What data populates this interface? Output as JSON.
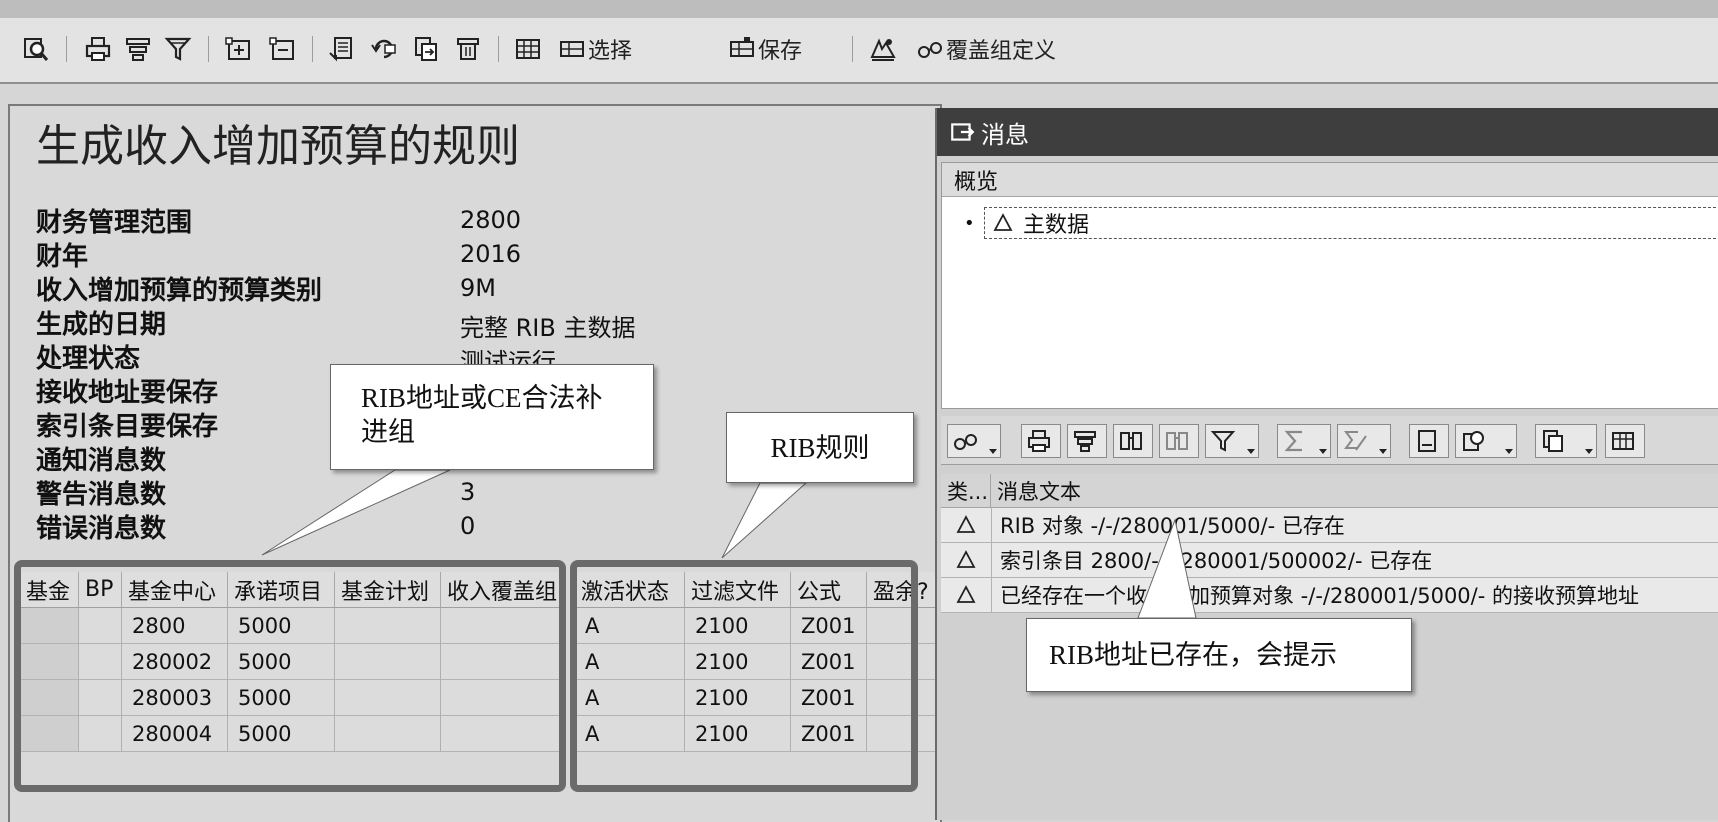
{
  "toolbar": {
    "buttons": [
      {
        "name": "details-button",
        "icon": "magnifier-icon"
      },
      {
        "name": "print-button",
        "icon": "printer-icon"
      },
      {
        "name": "sort-button",
        "icon": "sort-icon"
      },
      {
        "name": "filter-button",
        "icon": "funnel-icon"
      },
      {
        "name": "expand-button",
        "icon": "expand-icon"
      },
      {
        "name": "collapse-button",
        "icon": "collapse-icon"
      },
      {
        "name": "export-button",
        "icon": "document-icon"
      },
      {
        "name": "refresh-button",
        "icon": "refresh-icon"
      },
      {
        "name": "copy-button",
        "icon": "copy-icon"
      },
      {
        "name": "delete-button",
        "icon": "trash-icon"
      },
      {
        "name": "layout-button",
        "icon": "grid-icon"
      }
    ],
    "select_label": "选择",
    "save_label": "保存",
    "coverage_label": "覆盖组定义"
  },
  "report": {
    "title": "生成收入增加预算的规则",
    "fields": [
      {
        "label": "财务管理范围",
        "value": "2800"
      },
      {
        "label": "财年",
        "value": "2016"
      },
      {
        "label": "收入增加预算的预算类别",
        "value": "9M"
      },
      {
        "label": "生成的日期",
        "value": "完整  RIB 主数据"
      },
      {
        "label": "处理状态",
        "value": "测试运行"
      },
      {
        "label": "接收地址要保存",
        "value": ""
      },
      {
        "label": "索引条目要保存",
        "value": ""
      },
      {
        "label": "通知消息数",
        "value": "0"
      },
      {
        "label": "警告消息数",
        "value": "3"
      },
      {
        "label": "错误消息数",
        "value": "0"
      }
    ]
  },
  "grid": {
    "headers": [
      "基金",
      "BP",
      "基金中心",
      "承诺项目",
      "基金计划",
      "收入覆盖组",
      "激活状态",
      "过滤文件",
      "公式",
      "盈余?"
    ],
    "rows": [
      [
        "",
        "",
        "2800",
        "5000",
        "",
        "",
        "A",
        "2100",
        "Z001",
        ""
      ],
      [
        "",
        "",
        "280002",
        "5000",
        "",
        "",
        "A",
        "2100",
        "Z001",
        ""
      ],
      [
        "",
        "",
        "280003",
        "5000",
        "",
        "",
        "A",
        "2100",
        "Z001",
        ""
      ],
      [
        "",
        "",
        "280004",
        "5000",
        "",
        "",
        "A",
        "2100",
        "Z001",
        ""
      ]
    ]
  },
  "callouts": {
    "rib_address": "RIB地址或CE合法补进组",
    "rib_rules": "RIB规则",
    "rib_exists": "RIB地址已存在，会提示"
  },
  "messages": {
    "window_title": "消息",
    "overview_label": "概览",
    "tree_item": "主数据",
    "columns": [
      "类...",
      "消息文本"
    ],
    "rows": [
      {
        "type": "warning",
        "text": "RIB 对象 -/-/280001/5000/- 已存在"
      },
      {
        "type": "warning",
        "text": "索引条目 2800/-/-/280001/500002/- 已存在"
      },
      {
        "type": "warning",
        "text": "已经存在一个收入增加预算对象 -/-/280001/5000/- 的接收预算地址"
      }
    ]
  },
  "colors": {
    "background": "#d6d6d6",
    "title_bar": "#3e3e3e",
    "highlight_border": "#6a6a6a"
  }
}
